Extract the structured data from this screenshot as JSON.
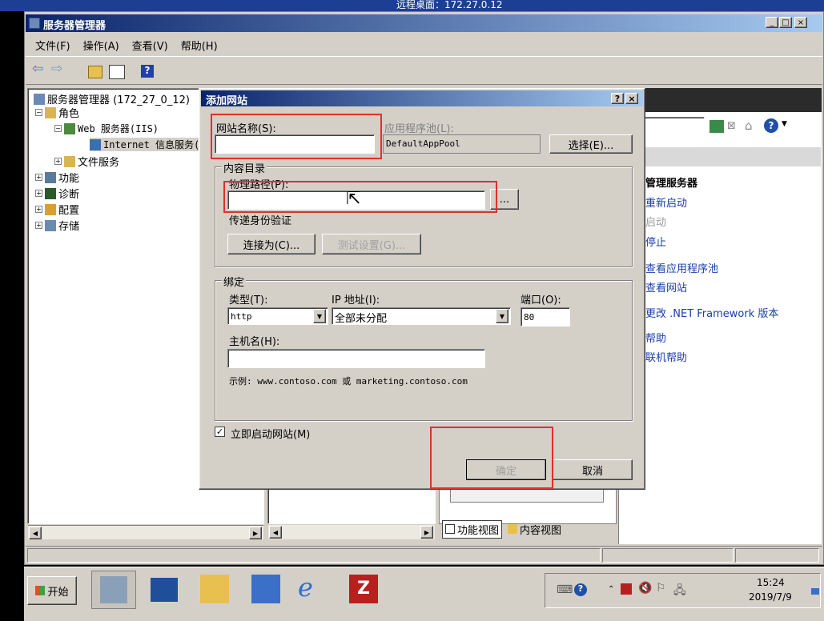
{
  "top_banner": {
    "text": "远程桌面：172.27.0.12"
  },
  "main_window": {
    "title": "服务器管理器",
    "menu": [
      "文件(F)",
      "操作(A)",
      "查看(V)",
      "帮助(H)"
    ]
  },
  "tree": {
    "root": "服务器管理器 (172_27_0_12)",
    "roles": "角色",
    "web_server": "Web 服务器(IIS)",
    "iis": "Internet 信息服务(IIS)管理器",
    "file_services": "文件服务",
    "features": "功能",
    "diagnostics": "诊断",
    "configuration": "配置",
    "storage": "存储"
  },
  "actions": {
    "header": "管理服务器",
    "items": [
      "重新启动",
      "启动",
      "停止",
      "查看应用程序池",
      "查看网站",
      "更改 .NET Framework 版本",
      "帮助",
      "联机帮助"
    ]
  },
  "bottom_tabs": {
    "feature_view": "功能视图",
    "content_view": "内容视图"
  },
  "dialog": {
    "title": "添加网站",
    "help_btn": "?",
    "close_btn": "×",
    "site_name_label": "网站名称(S):",
    "site_name_value": "",
    "app_pool_label": "应用程序池(L):",
    "app_pool_value": "DefaultAppPool",
    "select_btn": "选择(E)...",
    "content_dir_group": "内容目录",
    "physical_path_label": "物理路径(P):",
    "physical_path_value": "",
    "browse_btn": "...",
    "pass_auth_label": "传递身份验证",
    "connect_as_btn": "连接为(C)...",
    "test_settings_btn": "测试设置(G)...",
    "binding_group": "绑定",
    "type_label": "类型(T):",
    "type_value": "http",
    "ip_label": "IP 地址(I):",
    "ip_value": "全部未分配",
    "port_label": "端口(O):",
    "port_value": "80",
    "host_label": "主机名(H):",
    "host_value": "",
    "example_text": "示例: www.contoso.com 或 marketing.contoso.com",
    "start_now_label": "立即启动网站(M)",
    "start_now_checked": true,
    "ok_btn": "确定",
    "cancel_btn": "取消"
  },
  "taskbar": {
    "start": "开始",
    "time": "15:24",
    "date": "2019/7/9"
  },
  "colors": {
    "annotation_red": "#e0302b",
    "title_blue": "#0a246a"
  }
}
